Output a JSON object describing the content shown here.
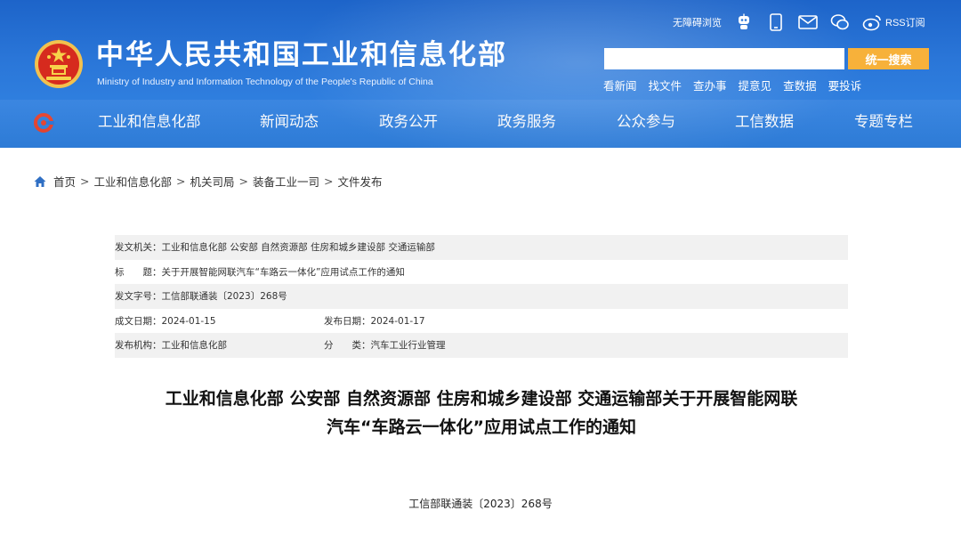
{
  "header": {
    "title_cn": "中华人民共和国工业和信息化部",
    "title_en": "Ministry of Industry and Information Technology of the People's Republic of China",
    "accessibility_link": "无障碍浏览",
    "rss_label": "RSS订阅",
    "search": {
      "placeholder": "",
      "button_label": "统一搜索"
    },
    "quick_links": [
      "看新闻",
      "找文件",
      "查办事",
      "提意见",
      "查数据",
      "要投诉"
    ],
    "nav": [
      "工业和信息化部",
      "新闻动态",
      "政务公开",
      "政务服务",
      "公众参与",
      "工信数据",
      "专题专栏"
    ]
  },
  "breadcrumb": {
    "separator": ">",
    "items": [
      "首页",
      "工业和信息化部",
      "机关司局",
      "装备工业一司",
      "文件发布"
    ]
  },
  "metadata": {
    "issuer": {
      "label": "发文机关：",
      "value": "工业和信息化部 公安部 自然资源部 住房和城乡建设部 交通运输部"
    },
    "title": {
      "label": "标　　题：",
      "value": "关于开展智能网联汽车“车路云一体化”应用试点工作的通知"
    },
    "doc_number": {
      "label": "发文字号：",
      "value": "工信部联通装〔2023〕268号"
    },
    "date_written": {
      "label": "成文日期：",
      "value": "2024-01-15"
    },
    "date_published": {
      "label": "发布日期：",
      "value": "2024-01-17"
    },
    "publisher": {
      "label": "发布机构：",
      "value": "工业和信息化部"
    },
    "category": {
      "label": "分　　类：",
      "value": "汽车工业行业管理"
    }
  },
  "document": {
    "title_line1": "工业和信息化部 公安部 自然资源部 住房和城乡建设部 交通运输部关于开展智能网联",
    "title_line2": "汽车“车路云一体化”应用试点工作的通知",
    "number": "工信部联通装〔2023〕268号"
  },
  "colors": {
    "header_blue": "#2a76d8",
    "search_button": "#f7b13a",
    "table_shade": "#f1f1f1"
  },
  "icons": [
    "national-emblem-icon",
    "robot-icon",
    "mobile-icon",
    "mail-icon",
    "weixin-icon",
    "weibo-icon",
    "nav-logo-icon",
    "home-icon"
  ]
}
